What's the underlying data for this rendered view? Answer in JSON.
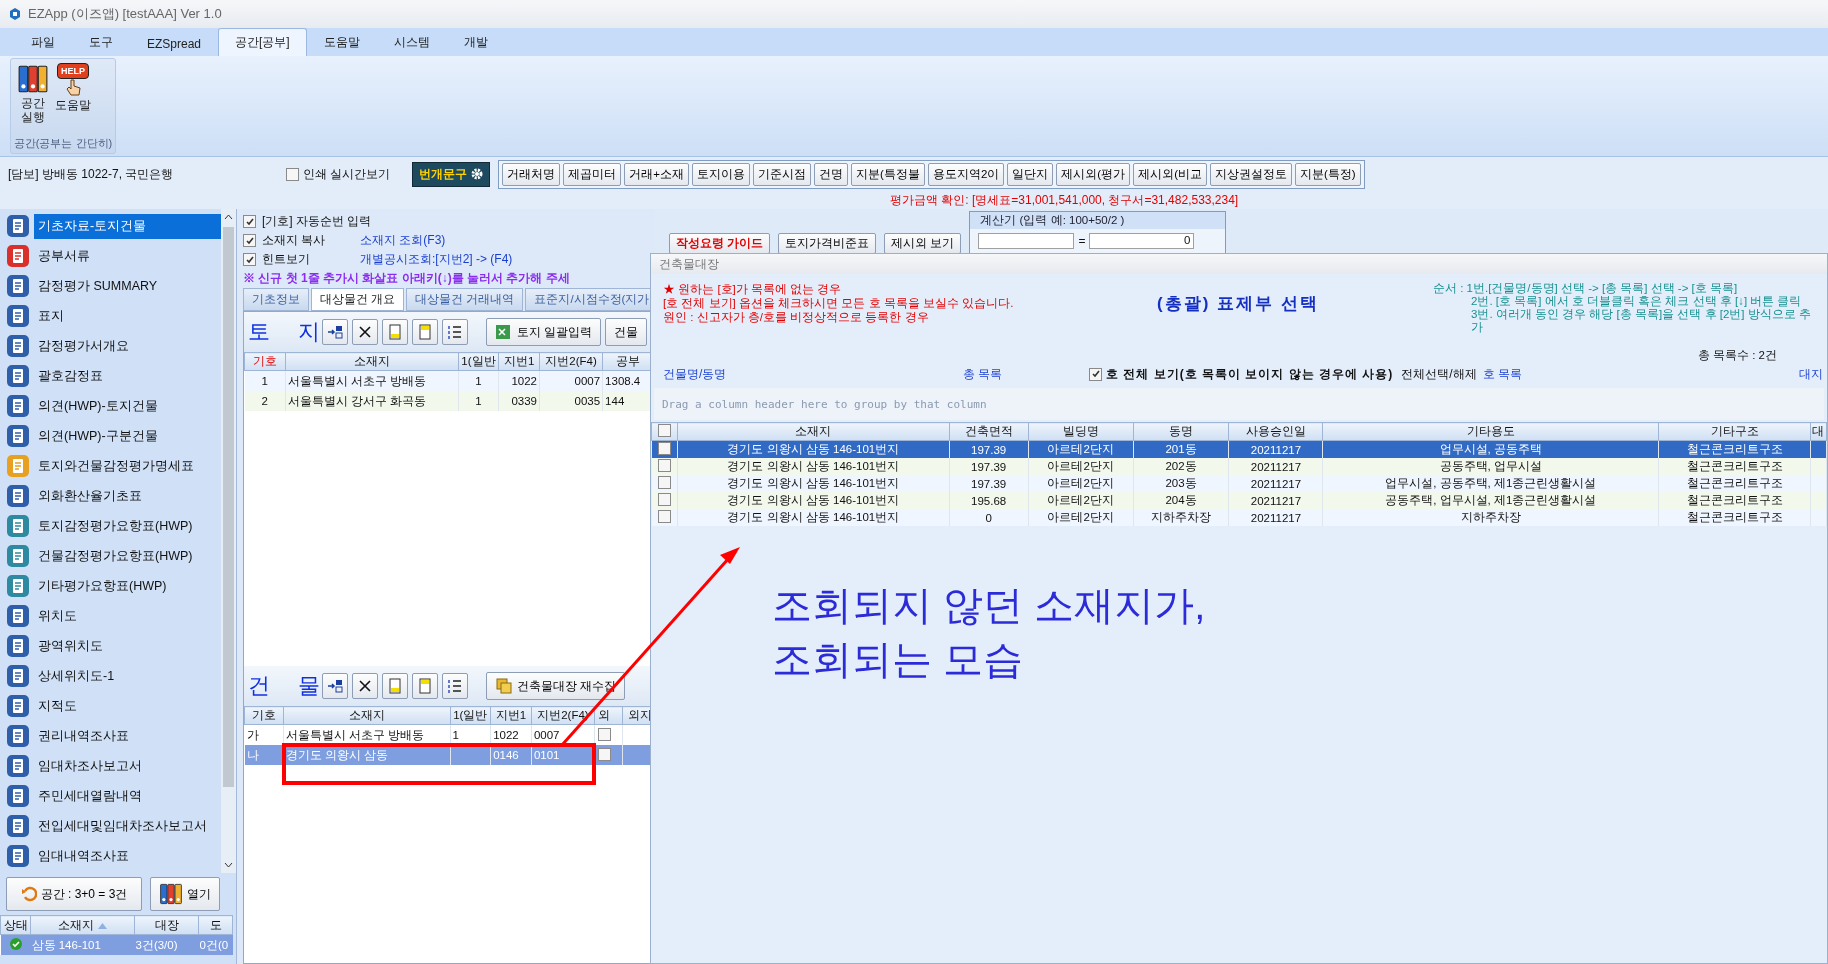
{
  "window": {
    "title": "EZApp (이즈앱) [testAAA] Ver 1.0"
  },
  "menu_tabs": [
    {
      "label": "파일",
      "selected": false
    },
    {
      "label": "도구",
      "selected": false
    },
    {
      "label": "EZSpread",
      "selected": false
    },
    {
      "label": "공간[공부]",
      "selected": true
    },
    {
      "label": "도움말",
      "selected": false
    },
    {
      "label": "시스템",
      "selected": false
    },
    {
      "label": "개발",
      "selected": false
    }
  ],
  "ribbon": {
    "run_button": [
      "공간",
      "실행"
    ],
    "help_badge": "HELP",
    "help_button": "도움말",
    "group_label": "공간(공부는 간단히)"
  },
  "toolbar": {
    "case_label": "[담보] 방배동 1022-7, 국민은행",
    "print_preview": {
      "label": "인쇄 실시간보기",
      "checked": false
    },
    "phrase_button": "번개문구",
    "buttons": [
      "거래처명",
      "제곱미터",
      "거래+소재",
      "토지이용",
      "기준시점",
      "건명",
      "지분(특정불",
      "용도지역2이",
      "일단지",
      "제시외(평가",
      "제시외(비교",
      "지상권설정토",
      "지분(특정)"
    ]
  },
  "valuation_check": "평가금액 확인: [명세표=31,001,541,000, 청구서=31,482,533,234]",
  "sidebar": {
    "items": [
      {
        "label": "기초자료-토지건물",
        "selected": true,
        "color": "#2f5fa8"
      },
      {
        "label": "공부서류",
        "selected": false,
        "color": "#d9302c"
      },
      {
        "label": "감정평가 SUMMARY",
        "selected": false,
        "color": "#2f5fa8"
      },
      {
        "label": "표지",
        "selected": false,
        "color": "#2f5fa8"
      },
      {
        "label": "감정평가서개요",
        "selected": false,
        "color": "#2f5fa8"
      },
      {
        "label": "괄호감정표",
        "selected": false,
        "color": "#2f5fa8"
      },
      {
        "label": "의견(HWP)-토지건물",
        "selected": false,
        "color": "#2f5fa8"
      },
      {
        "label": "의견(HWP)-구분건물",
        "selected": false,
        "color": "#2f5fa8"
      },
      {
        "label": "토지와건물감정평가명세표",
        "selected": false,
        "color": "#e8a020"
      },
      {
        "label": "외화환산율기초표",
        "selected": false,
        "color": "#2f5fa8"
      },
      {
        "label": "토지감정평가요항표(HWP)",
        "selected": false,
        "color": "#2e8aa0"
      },
      {
        "label": "건물감정평가요항표(HWP)",
        "selected": false,
        "color": "#2e8aa0"
      },
      {
        "label": "기타평가요항표(HWP)",
        "selected": false,
        "color": "#2e8aa0"
      },
      {
        "label": "위치도",
        "selected": false,
        "color": "#2f5fa8"
      },
      {
        "label": "광역위치도",
        "selected": false,
        "color": "#2f5fa8"
      },
      {
        "label": "상세위치도-1",
        "selected": false,
        "color": "#2f5fa8"
      },
      {
        "label": "지적도",
        "selected": false,
        "color": "#2f5fa8"
      },
      {
        "label": "권리내역조사표",
        "selected": false,
        "color": "#2f5fa8"
      },
      {
        "label": "임대차조사보고서",
        "selected": false,
        "color": "#2f5fa8"
      },
      {
        "label": "주민세대열람내역",
        "selected": false,
        "color": "#2f5fa8"
      },
      {
        "label": "전입세대및임대차조사보고서",
        "selected": false,
        "color": "#2f5fa8"
      },
      {
        "label": "임대내역조사표",
        "selected": false,
        "color": "#2f5fa8"
      }
    ],
    "count_button": "공간 : 3+0 = 3건",
    "open_button": "열기",
    "table": {
      "columns": [
        "상태",
        "소재지",
        "대장",
        "도"
      ],
      "rows": [
        {
          "done": true,
          "selected": true,
          "cells": [
            "",
            "삼동 146-101",
            "3건(3/0)",
            "0건(0"
          ]
        }
      ]
    }
  },
  "options": [
    {
      "label": "[기호] 자동순번 입력",
      "checked": true
    },
    {
      "label": "소재지 복사",
      "checked": true,
      "link": "소재지 조회(F3)"
    },
    {
      "label": "힌트보기",
      "checked": true,
      "link": "개별공시조회:[지번2] -> (F4)"
    }
  ],
  "notice": "※ 신규 첫 1줄 추가시 화살표 아래키(↓)를 눌러서 추가해 주세",
  "guide_buttons": [
    "작성요령 가이드",
    "토지가격비준표",
    "제시외 보기"
  ],
  "calculator": {
    "title": "계산기  (입력 예: 100+50/2 )",
    "equals": "=",
    "result": "0"
  },
  "content_tabs": [
    {
      "label": "기초정보",
      "selected": false
    },
    {
      "label": "대상물건 개요",
      "selected": true
    },
    {
      "label": "대상물건 거래내역",
      "selected": false
    },
    {
      "label": "표준지/시점수정(지가",
      "selected": false
    }
  ],
  "land": {
    "title": "토 지",
    "batch_button": "토지 일괄입력",
    "next_button": "건물",
    "columns": [
      "기호",
      "소재지",
      "1(일반",
      "지번1",
      "지번2(F4)",
      "공부"
    ],
    "rows": [
      {
        "cells": [
          "1",
          "서울특별시 서초구 방배동",
          "1",
          "1022",
          "0007",
          "1308.4"
        ]
      },
      {
        "cells": [
          "2",
          "서울특별시 강서구 화곡동",
          "1",
          "0339",
          "0035",
          "144"
        ]
      }
    ]
  },
  "building": {
    "title": "건 물",
    "recollect_button": "건축물대장 재수집",
    "columns": [
      "기호",
      "소재지",
      "1(일반",
      "지번1",
      "지번2(F4)",
      "외",
      "외지"
    ],
    "rows": [
      {
        "selected": false,
        "checked": false,
        "cells": [
          "가",
          "서울특별시 서초구 방배동",
          "1",
          "1022",
          "0007"
        ]
      },
      {
        "selected": true,
        "checked": false,
        "cells": [
          "나",
          "경기도 의왕시 삼동",
          "",
          "0146",
          "0101"
        ]
      }
    ]
  },
  "dialog": {
    "title": "건축물대장",
    "notes": [
      "★ 원하는 [호]가 목록에 없는 경우",
      "[호 전체 보기] 옵션을 체크하시면 모든 호 목록을 보실수 있습니다.",
      "원인 : 신고자가 층/호를 비정상적으로 등록한 경우"
    ],
    "heading": "(총괄) 표제부 선택",
    "steps": [
      "순서 : 1번.[건물명/동명] 선택 -> [총 목록] 선택 -> [호 목록]",
      "2번. [호 목록] 에서 호 더블클릭 혹은 체크 선택 후 [↓] 버튼 클릭",
      "3번. 여러개 동인 경우 해당 [총 목록]을 선택 후 [2번] 방식으로 추가"
    ],
    "total": "총 목록수 : 2건",
    "building_label": "건물명/동명",
    "list_label": "총 목록",
    "show_all": {
      "label": "호 전체 보기(호 목록이 보이지 않는 경우에 사용)",
      "checked": true
    },
    "select_all": "전체선택/해제",
    "unit_label": "호 목록",
    "land_label": "대지",
    "group_hint": "Drag a column header here to group by that column",
    "header_checked": false,
    "columns": [
      "소재지",
      "건축면적",
      "빌딩명",
      "동명",
      "사용승인일",
      "기타용도",
      "기타구조",
      "대"
    ],
    "rows": [
      {
        "selected": true,
        "checked": false,
        "cells": [
          "경기도 의왕시 삼동 146-101번지",
          "197.39",
          "아르테2단지",
          "201동",
          "20211217",
          "업무시설, 공동주택",
          "철근콘크리트구조"
        ]
      },
      {
        "selected": false,
        "checked": false,
        "cells": [
          "경기도 의왕시 삼동 146-101번지",
          "197.39",
          "아르테2단지",
          "202동",
          "20211217",
          "공동주택, 업무시설",
          "철근콘크리트구조"
        ]
      },
      {
        "selected": false,
        "checked": false,
        "cells": [
          "경기도 의왕시 삼동 146-101번지",
          "197.39",
          "아르테2단지",
          "203동",
          "20211217",
          "업무시설, 공동주택,  제1종근린생활시설",
          "철근콘크리트구조"
        ]
      },
      {
        "selected": false,
        "checked": false,
        "cells": [
          "경기도 의왕시 삼동 146-101번지",
          "195.68",
          "아르테2단지",
          "204동",
          "20211217",
          "공동주택, 업무시설, 제1종근린생활시설",
          "철근콘크리트구조"
        ]
      },
      {
        "selected": false,
        "checked": false,
        "cells": [
          "경기도 의왕시 삼동 146-101번지",
          "0",
          "아르테2단지",
          "지하주차장",
          "20211217",
          "지하주차장",
          "철근콘크리트구조"
        ]
      }
    ]
  },
  "annotation": {
    "lines": [
      "조회되지 않던 소재지가,",
      "조회되는 모습"
    ]
  }
}
